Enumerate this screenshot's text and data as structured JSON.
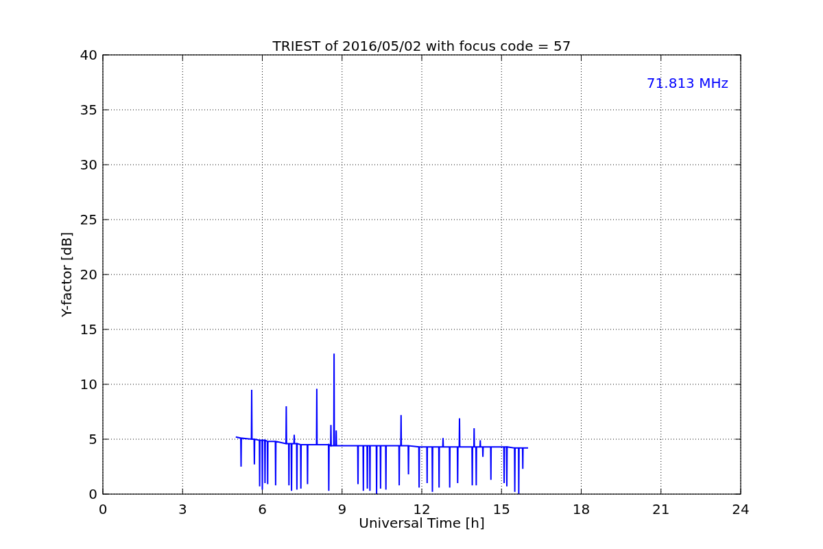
{
  "chart_data": {
    "type": "line",
    "title": "TRIEST of 2016/05/02 with focus code = 57",
    "xlabel": "Universal Time [h]",
    "ylabel": "Y-factor [dB]",
    "xlim": [
      0,
      24
    ],
    "ylim": [
      0,
      40
    ],
    "xticks": [
      0,
      3,
      6,
      9,
      12,
      15,
      18,
      21,
      24
    ],
    "yticks": [
      0,
      5,
      10,
      15,
      20,
      25,
      30,
      35,
      40
    ],
    "grid": true,
    "annotations": [
      "71.813 MHz"
    ],
    "series": [
      {
        "color": "#0000ff",
        "x": [
          5.0,
          5.19,
          5.2,
          5.21,
          5.59,
          5.6,
          5.61,
          5.69,
          5.7,
          5.71,
          5.89,
          5.9,
          5.91,
          5.99,
          6.0,
          6.01,
          6.09,
          6.1,
          6.11,
          6.19,
          6.2,
          6.21,
          6.49,
          6.5,
          6.51,
          6.89,
          6.9,
          6.91,
          6.99,
          7.0,
          7.01,
          7.09,
          7.1,
          7.11,
          7.19,
          7.2,
          7.21,
          7.29,
          7.3,
          7.31,
          7.44,
          7.45,
          7.46,
          7.69,
          7.7,
          7.71,
          8.04,
          8.05,
          8.06,
          8.49,
          8.5,
          8.51,
          8.57,
          8.58,
          8.59,
          8.69,
          8.7,
          8.71,
          8.77,
          8.78,
          8.79,
          9.59,
          9.6,
          9.61,
          9.79,
          9.8,
          9.81,
          9.94,
          9.95,
          9.96,
          10.04,
          10.05,
          10.06,
          10.29,
          10.3,
          10.31,
          10.44,
          10.45,
          10.46,
          10.64,
          10.65,
          10.66,
          11.14,
          11.15,
          11.16,
          11.21,
          11.22,
          11.23,
          11.49,
          11.5,
          11.51,
          11.89,
          11.9,
          11.91,
          12.19,
          12.2,
          12.21,
          12.39,
          12.4,
          12.41,
          12.64,
          12.65,
          12.66,
          12.79,
          12.8,
          12.81,
          13.04,
          13.05,
          13.06,
          13.34,
          13.35,
          13.36,
          13.41,
          13.42,
          13.43,
          13.89,
          13.9,
          13.91,
          13.96,
          13.97,
          13.98,
          14.04,
          14.05,
          14.06,
          14.19,
          14.2,
          14.21,
          14.29,
          14.3,
          14.31,
          14.59,
          14.6,
          14.61,
          15.09,
          15.1,
          15.11,
          15.19,
          15.2,
          15.21,
          15.49,
          15.5,
          15.51,
          15.64,
          15.65,
          15.66,
          15.79,
          15.8,
          15.81,
          16.0
        ],
        "values": [
          5.2,
          5.1,
          2.5,
          5.1,
          5.0,
          9.5,
          5.0,
          5.0,
          2.7,
          5.0,
          4.9,
          0.7,
          4.9,
          4.9,
          0.4,
          4.9,
          4.9,
          1.0,
          4.9,
          4.8,
          0.9,
          4.8,
          4.8,
          0.8,
          4.8,
          4.6,
          8.0,
          4.6,
          4.6,
          0.8,
          4.6,
          4.6,
          0.3,
          4.6,
          4.6,
          5.4,
          4.6,
          4.6,
          0.4,
          4.6,
          4.5,
          0.5,
          4.5,
          4.5,
          0.9,
          4.5,
          4.5,
          9.6,
          4.5,
          4.5,
          0.3,
          4.5,
          4.4,
          6.3,
          4.4,
          4.4,
          12.8,
          4.4,
          4.4,
          5.8,
          4.4,
          4.4,
          0.9,
          4.4,
          4.4,
          0.3,
          4.4,
          4.4,
          0.5,
          4.4,
          4.4,
          0.3,
          4.4,
          4.4,
          0.0,
          4.4,
          4.4,
          0.5,
          4.4,
          4.4,
          0.4,
          4.4,
          4.4,
          0.8,
          4.4,
          4.4,
          7.2,
          4.4,
          4.4,
          1.8,
          4.4,
          4.3,
          0.6,
          4.3,
          4.3,
          1.0,
          4.3,
          4.3,
          0.2,
          4.3,
          4.3,
          0.6,
          4.3,
          4.3,
          5.1,
          4.3,
          4.3,
          0.6,
          4.3,
          4.3,
          1.0,
          4.3,
          4.3,
          6.9,
          4.3,
          4.3,
          0.8,
          4.3,
          4.3,
          6.0,
          4.3,
          4.3,
          0.8,
          4.3,
          4.3,
          4.9,
          4.3,
          4.3,
          3.4,
          4.3,
          4.3,
          1.3,
          4.3,
          4.3,
          1.0,
          4.3,
          4.3,
          0.7,
          4.3,
          4.2,
          0.2,
          4.2,
          4.2,
          0.0,
          4.2,
          4.2,
          2.3,
          4.2,
          4.2
        ]
      }
    ]
  }
}
